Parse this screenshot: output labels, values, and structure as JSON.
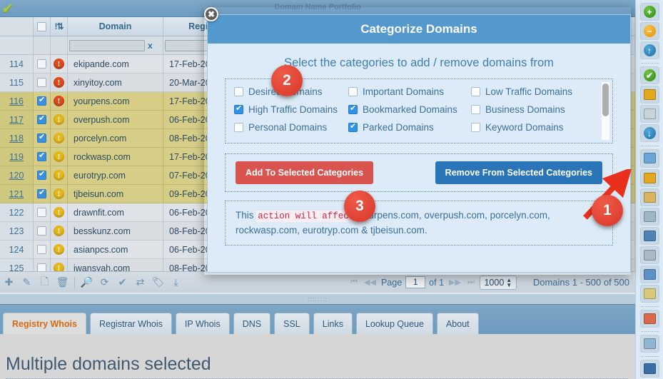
{
  "window": {
    "title": "Domain Name Portfolio",
    "app_check_icon": "green-check-icon"
  },
  "table": {
    "columns": [
      "",
      "",
      "",
      "Domain",
      "Registry Ex"
    ],
    "filter_clear_label": "x",
    "sort_icon": "sort-icon",
    "rows": [
      {
        "num": "114",
        "checked": false,
        "severity": "red",
        "domain": "ekipande.com",
        "expiry": "17-Feb-20"
      },
      {
        "num": "115",
        "checked": false,
        "severity": "red",
        "domain": "xinyitoy.com",
        "expiry": "20-Mar-20"
      },
      {
        "num": "116",
        "checked": true,
        "severity": "red",
        "domain": "yourpens.com",
        "expiry": "17-Feb-20"
      },
      {
        "num": "117",
        "checked": true,
        "severity": "yellow",
        "domain": "overpush.com",
        "expiry": "06-Feb-20"
      },
      {
        "num": "118",
        "checked": true,
        "severity": "yellow",
        "domain": "porcelyn.com",
        "expiry": "08-Feb-20"
      },
      {
        "num": "119",
        "checked": true,
        "severity": "yellow",
        "domain": "rockwasp.com",
        "expiry": "17-Feb-20"
      },
      {
        "num": "120",
        "checked": true,
        "severity": "yellow",
        "domain": "eurotryp.com",
        "expiry": "07-Feb-20"
      },
      {
        "num": "121",
        "checked": true,
        "severity": "yellow",
        "domain": "tjbeisun.com",
        "expiry": "09-Feb-20"
      },
      {
        "num": "122",
        "checked": false,
        "severity": "yellow",
        "domain": "drawnfit.com",
        "expiry": "06-Feb-20"
      },
      {
        "num": "123",
        "checked": false,
        "severity": "yellow",
        "domain": "besskunz.com",
        "expiry": "08-Feb-20"
      },
      {
        "num": "124",
        "checked": false,
        "severity": "yellow",
        "domain": "asianpcs.com",
        "expiry": "06-Feb-20"
      },
      {
        "num": "125",
        "checked": false,
        "severity": "yellow",
        "domain": "iwansyah.com",
        "expiry": "08-Feb-20"
      }
    ]
  },
  "gridbar": {
    "icons": [
      "add-icon",
      "edit-icon",
      "copy-icon",
      "delete-icon",
      "search-icon",
      "refresh-icon",
      "check-icon",
      "transfer-icon",
      "tag-icon",
      "download-icon"
    ],
    "page_label": "Page",
    "page_value": "1",
    "of_label": "of 1",
    "page_size": "1000",
    "record_count": "Domains 1 - 500 of 500"
  },
  "tabs": [
    {
      "label": "Registry Whois",
      "active": true
    },
    {
      "label": "Registrar Whois",
      "active": false
    },
    {
      "label": "IP Whois",
      "active": false
    },
    {
      "label": "DNS",
      "active": false
    },
    {
      "label": "SSL",
      "active": false
    },
    {
      "label": "Links",
      "active": false
    },
    {
      "label": "Lookup Queue",
      "active": false
    },
    {
      "label": "About",
      "active": false
    }
  ],
  "content": {
    "title": "Multiple domains selected"
  },
  "rail": {
    "items": [
      {
        "icon": "add-green-icon",
        "type": "dot",
        "color": "green",
        "glyph": "+"
      },
      {
        "icon": "remove-orange-icon",
        "type": "dot",
        "color": "orange",
        "glyph": "−"
      },
      {
        "icon": "upload-blue-icon",
        "type": "dot",
        "color": "blue",
        "glyph": "↑"
      },
      {
        "icon": "separator",
        "type": "sep"
      },
      {
        "icon": "verify-green-check-icon",
        "type": "dot",
        "color": "green",
        "glyph": "✔"
      },
      {
        "icon": "categorize-domains-icon",
        "type": "sq",
        "color": "#e3a81c"
      },
      {
        "icon": "tag-icon",
        "type": "sq",
        "color": "#c9d3da"
      },
      {
        "icon": "download-blue-icon",
        "type": "dot",
        "color": "blue",
        "glyph": "↓"
      },
      {
        "icon": "separator",
        "type": "sep"
      },
      {
        "icon": "new-record-icon",
        "type": "sq",
        "color": "#6ba7d6"
      },
      {
        "icon": "folder-settings-icon",
        "type": "sq",
        "color": "#e3a81c"
      },
      {
        "icon": "edit-settings-icon",
        "type": "sq",
        "color": "#d6b55e"
      },
      {
        "icon": "report-settings-icon",
        "type": "sq",
        "color": "#9fb6c6"
      },
      {
        "icon": "globe-settings-icon",
        "type": "sq",
        "color": "#4f83b5"
      },
      {
        "icon": "tools-icon",
        "type": "sq",
        "color": "#a8b8c4"
      },
      {
        "icon": "window-check-icon",
        "type": "sq",
        "color": "#5b91c4"
      },
      {
        "icon": "clipboard-check-icon",
        "type": "sq",
        "color": "#d8c978"
      },
      {
        "icon": "separator",
        "type": "sep"
      },
      {
        "icon": "palette-settings-icon",
        "type": "sq",
        "color": "#d86a4a"
      },
      {
        "icon": "separator",
        "type": "sep"
      },
      {
        "icon": "gear-check-icon",
        "type": "sq",
        "color": "#8fb5cf"
      },
      {
        "icon": "separator",
        "type": "sep"
      },
      {
        "icon": "book-icon",
        "type": "sq",
        "color": "#3a6ea5"
      }
    ]
  },
  "modal": {
    "title": "Categorize Domains",
    "close_label": "✖",
    "subtitle": "Select the categories to add / remove domains from",
    "categories": [
      {
        "label": "Desired Domains",
        "checked": false
      },
      {
        "label": "Important Domains",
        "checked": false
      },
      {
        "label": "Low Traffic Domains",
        "checked": false
      },
      {
        "label": "High Traffic Domains",
        "checked": true
      },
      {
        "label": "Bookmarked Domains",
        "checked": true
      },
      {
        "label": "Business Domains",
        "checked": false
      },
      {
        "label": "Personal Domains",
        "checked": false
      },
      {
        "label": "Parked Domains",
        "checked": true
      },
      {
        "label": "Keyword Domains",
        "checked": false
      }
    ],
    "add_button": "Add To Selected Categories",
    "remove_button": "Remove From Selected Categories",
    "info_prefix": "This",
    "info_emphasis": "action will affect",
    "info_domains": "yourpens.com, overpush.com, porcelyn.com, rockwasp.com, eurotryp.com & tjbeisun.com."
  },
  "annotations": {
    "badge1": "1",
    "badge2": "2",
    "badge3": "3",
    "arrow_color": "#e8301c"
  }
}
